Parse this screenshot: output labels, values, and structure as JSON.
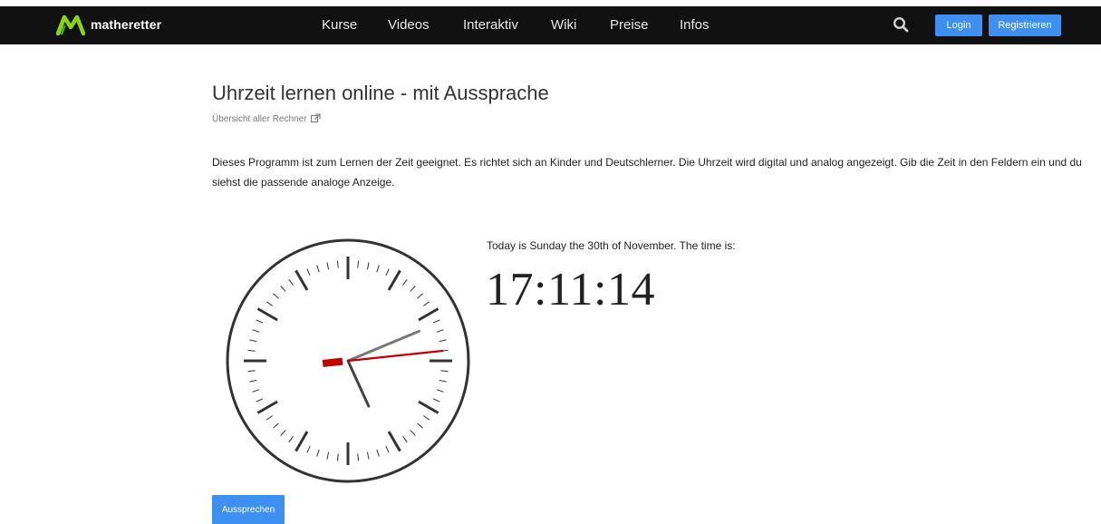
{
  "header": {
    "brand": "matheretter",
    "nav": [
      "Kurse",
      "Videos",
      "Interaktiv",
      "Wiki",
      "Preise",
      "Infos"
    ],
    "login_label": "Login",
    "register_label": "Registrieren",
    "accent_color": "#3e8ff2",
    "logo_colors": [
      "#8bd11a",
      "#3aa635"
    ]
  },
  "page": {
    "title": "Uhrzeit lernen online - mit Aussprache",
    "overview_link": "Übersicht aller Rechner",
    "description": "Dieses Programm ist zum Lernen der Zeit geeignet. Es richtet sich an Kinder und Deutschlerner. Die Uhrzeit wird digital und analog angezeigt. Gib die Zeit in den Feldern ein und du siehst die passende analoge Anzeige."
  },
  "clock": {
    "date_text": "Today is Sunday the 30th of November. The time is:",
    "time_text": "17:11:14",
    "hours": 17,
    "minutes": 11,
    "seconds": 14,
    "second_hand_color": "#c00000"
  },
  "speak_button_label": "Aussprechen"
}
